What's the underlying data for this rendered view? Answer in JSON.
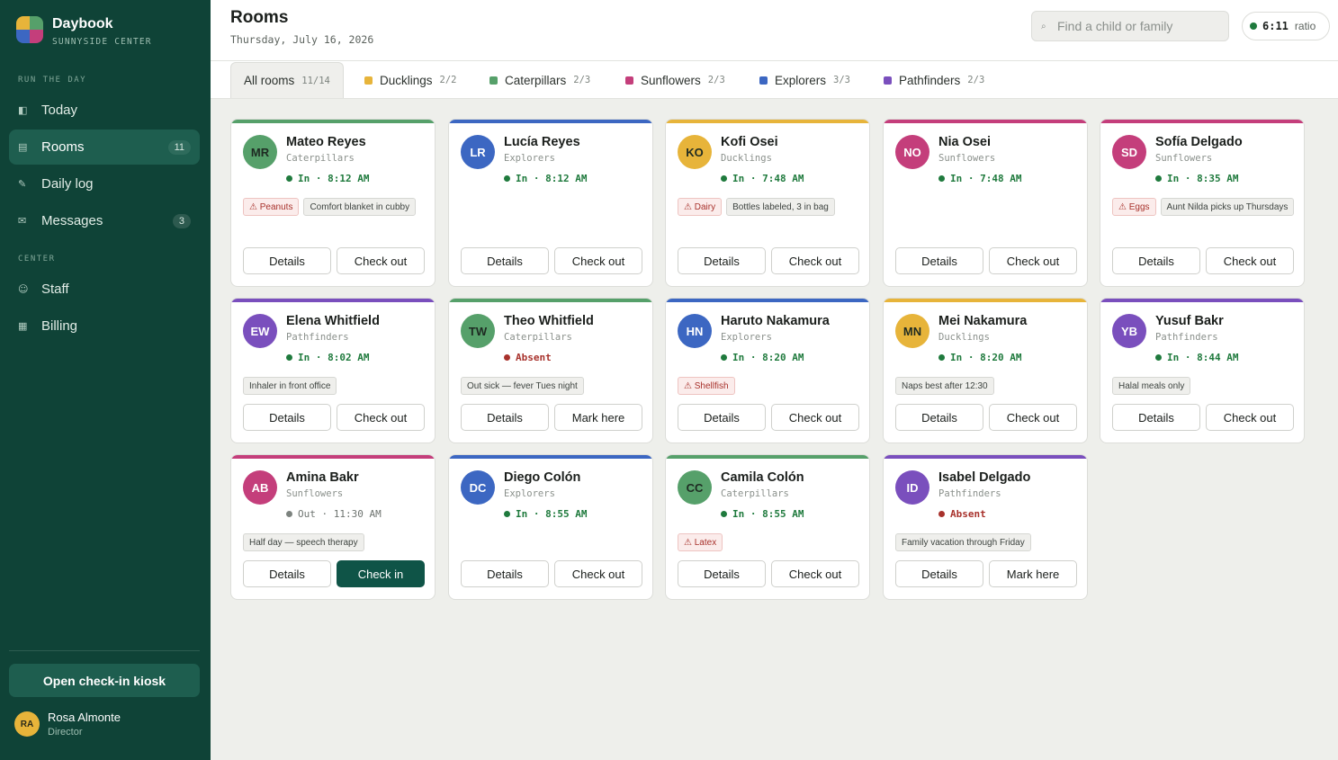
{
  "app": {
    "name": "Daybook",
    "center": "SUNNYSIDE CENTER"
  },
  "nav": {
    "section_day": "RUN THE DAY",
    "section_center": "CENTER",
    "items": [
      {
        "label": "Today",
        "icon": "today-icon",
        "badge": ""
      },
      {
        "label": "Rooms",
        "icon": "rooms-icon",
        "badge": "11",
        "active": true
      },
      {
        "label": "Daily log",
        "icon": "pencil-icon",
        "badge": ""
      },
      {
        "label": "Messages",
        "icon": "mail-icon",
        "badge": "3"
      },
      {
        "label": "Staff",
        "icon": "staff-icon",
        "badge": ""
      },
      {
        "label": "Billing",
        "icon": "billing-icon",
        "badge": ""
      }
    ],
    "kiosk_button": "Open check-in kiosk"
  },
  "user": {
    "initials": "RA",
    "name": "Rosa Almonte",
    "role": "Director"
  },
  "header": {
    "title": "Rooms",
    "date": "Thursday, July 16, 2026",
    "search_placeholder": "Find a child or family",
    "ratio_value": "6:11",
    "ratio_label": "ratio"
  },
  "tabs": [
    {
      "label": "All rooms",
      "count": "11/14",
      "color": "",
      "active": true
    },
    {
      "label": "Ducklings",
      "count": "2/2",
      "color": "#e7b43a"
    },
    {
      "label": "Caterpillars",
      "count": "2/3",
      "color": "#56a06a"
    },
    {
      "label": "Sunflowers",
      "count": "2/3",
      "color": "#c43e7b"
    },
    {
      "label": "Explorers",
      "count": "3/3",
      "color": "#3c67c2"
    },
    {
      "label": "Pathfinders",
      "count": "2/3",
      "color": "#7a4fbd"
    }
  ],
  "room_colors": {
    "Ducklings": "#e7b43a",
    "Caterpillars": "#56a06a",
    "Sunflowers": "#c43e7b",
    "Explorers": "#3c67c2",
    "Pathfinders": "#7a4fbd"
  },
  "children": [
    {
      "initials": "MR",
      "name": "Mateo Reyes",
      "room": "Caterpillars",
      "status": "in",
      "status_text": "In · 8:12 AM",
      "allergy": "Peanuts",
      "notes": [
        "Comfort blanket in cubby"
      ],
      "actions": [
        "Details",
        "Check out"
      ]
    },
    {
      "initials": "LR",
      "name": "Lucía Reyes",
      "room": "Explorers",
      "status": "in",
      "status_text": "In · 8:12 AM",
      "allergy": "",
      "notes": [],
      "actions": [
        "Details",
        "Check out"
      ]
    },
    {
      "initials": "KO",
      "name": "Kofi Osei",
      "room": "Ducklings",
      "status": "in",
      "status_text": "In · 7:48 AM",
      "allergy": "Dairy",
      "notes": [
        "Bottles labeled, 3 in bag"
      ],
      "actions": [
        "Details",
        "Check out"
      ]
    },
    {
      "initials": "NO",
      "name": "Nia Osei",
      "room": "Sunflowers",
      "status": "in",
      "status_text": "In · 7:48 AM",
      "allergy": "",
      "notes": [],
      "actions": [
        "Details",
        "Check out"
      ]
    },
    {
      "initials": "SD",
      "name": "Sofía Delgado",
      "room": "Sunflowers",
      "status": "in",
      "status_text": "In · 8:35 AM",
      "allergy": "Eggs",
      "notes": [
        "Aunt Nilda picks up Thursdays"
      ],
      "actions": [
        "Details",
        "Check out"
      ]
    },
    {
      "initials": "EW",
      "name": "Elena Whitfield",
      "room": "Pathfinders",
      "status": "in",
      "status_text": "In · 8:02 AM",
      "allergy": "",
      "notes": [
        "Inhaler in front office"
      ],
      "actions": [
        "Details",
        "Check out"
      ]
    },
    {
      "initials": "TW",
      "name": "Theo Whitfield",
      "room": "Caterpillars",
      "status": "absent",
      "status_text": "Absent",
      "allergy": "",
      "notes": [
        "Out sick — fever Tues night"
      ],
      "actions": [
        "Details",
        "Mark here"
      ]
    },
    {
      "initials": "HN",
      "name": "Haruto Nakamura",
      "room": "Explorers",
      "status": "in",
      "status_text": "In · 8:20 AM",
      "allergy": "Shellfish",
      "notes": [],
      "actions": [
        "Details",
        "Check out"
      ]
    },
    {
      "initials": "MN",
      "name": "Mei Nakamura",
      "room": "Ducklings",
      "status": "in",
      "status_text": "In · 8:20 AM",
      "allergy": "",
      "notes": [
        "Naps best after 12:30"
      ],
      "actions": [
        "Details",
        "Check out"
      ]
    },
    {
      "initials": "YB",
      "name": "Yusuf Bakr",
      "room": "Pathfinders",
      "status": "in",
      "status_text": "In · 8:44 AM",
      "allergy": "",
      "notes": [
        "Halal meals only"
      ],
      "actions": [
        "Details",
        "Check out"
      ]
    },
    {
      "initials": "AB",
      "name": "Amina Bakr",
      "room": "Sunflowers",
      "status": "out",
      "status_text": "Out · 11:30 AM",
      "allergy": "",
      "notes": [
        "Half day — speech therapy"
      ],
      "actions": [
        "Details",
        "Check in"
      ]
    },
    {
      "initials": "DC",
      "name": "Diego Colón",
      "room": "Explorers",
      "status": "in",
      "status_text": "In · 8:55 AM",
      "allergy": "",
      "notes": [],
      "actions": [
        "Details",
        "Check out"
      ]
    },
    {
      "initials": "CC",
      "name": "Camila Colón",
      "room": "Caterpillars",
      "status": "in",
      "status_text": "In · 8:55 AM",
      "allergy": "Latex",
      "notes": [],
      "actions": [
        "Details",
        "Check out"
      ]
    },
    {
      "initials": "ID",
      "name": "Isabel Delgado",
      "room": "Pathfinders",
      "status": "absent",
      "status_text": "Absent",
      "allergy": "",
      "notes": [
        "Family vacation through Friday"
      ],
      "actions": [
        "Details",
        "Mark here"
      ]
    }
  ]
}
